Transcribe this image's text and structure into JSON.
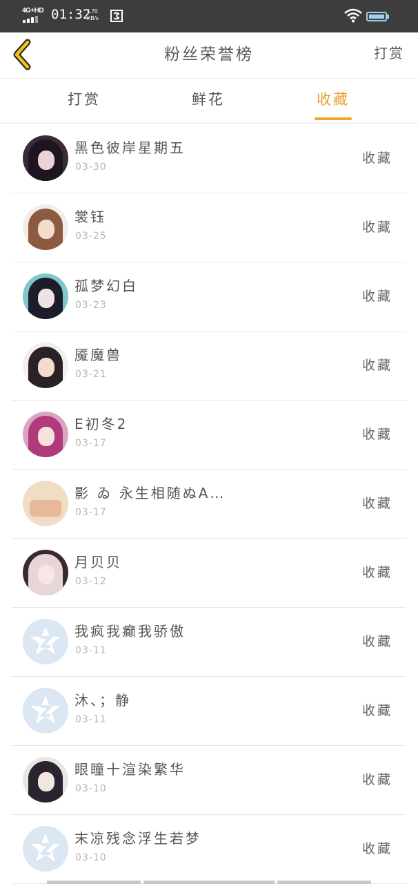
{
  "status_bar": {
    "network": "4G+HD",
    "time": "01:32",
    "speed_value": "1.70",
    "speed_unit": "KB/s",
    "icons": [
      "signal-icon",
      "screenshot-app-icon",
      "wifi-icon",
      "battery-icon"
    ]
  },
  "header": {
    "title": "粉丝荣誉榜",
    "right_action": "打赏",
    "back_icon": "back-arrow-icon",
    "accent_color": "#f0a52a"
  },
  "tabs": [
    {
      "label": "打赏",
      "active": false
    },
    {
      "label": "鲜花",
      "active": false
    },
    {
      "label": "收藏",
      "active": true
    }
  ],
  "list": {
    "items": [
      {
        "name": "黑色彼岸星期五",
        "date": "03-30",
        "action": "收藏",
        "avatar": "photo"
      },
      {
        "name": "裳钰",
        "date": "03-25",
        "action": "收藏",
        "avatar": "photo"
      },
      {
        "name": "孤梦幻白",
        "date": "03-23",
        "action": "收藏",
        "avatar": "photo"
      },
      {
        "name": "魇魔兽",
        "date": "03-21",
        "action": "收藏",
        "avatar": "photo"
      },
      {
        "name": "E初冬2",
        "date": "03-17",
        "action": "收藏",
        "avatar": "photo"
      },
      {
        "name": "影 ゐ 永生相随ぬA…",
        "date": "03-17",
        "action": "收藏",
        "avatar": "photo"
      },
      {
        "name": "月贝贝",
        "date": "03-12",
        "action": "收藏",
        "avatar": "photo"
      },
      {
        "name": "我疯我癫我骄傲",
        "date": "03-11",
        "action": "收藏",
        "avatar": "default"
      },
      {
        "name": "沐、；静",
        "date": "03-11",
        "action": "收藏",
        "avatar": "default"
      },
      {
        "name": "眼瞳十渲染繁华",
        "date": "03-10",
        "action": "收藏",
        "avatar": "photo"
      },
      {
        "name": "末凉残念浮生若梦",
        "date": "03-10",
        "action": "收藏",
        "avatar": "default"
      }
    ]
  }
}
